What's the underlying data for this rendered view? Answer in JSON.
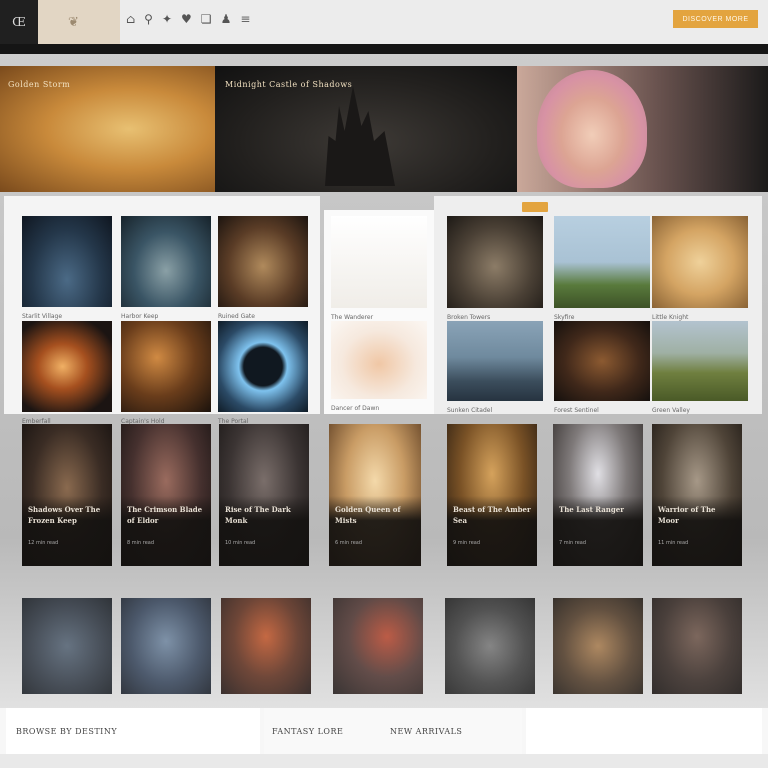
{
  "topbar": {
    "logo": "Œ",
    "cta_label": "DISCOVER MORE"
  },
  "hero": [
    {
      "caption": "Golden Storm"
    },
    {
      "caption": "Midnight Castle of Shadows"
    },
    {
      "caption": ""
    }
  ],
  "gallery_left": [
    {
      "caption": "Starlit Village",
      "gradient": "radial-gradient(ellipse at 50% 70%, #4b6a86 0%, #24374a 55%, #0f1620 100%)"
    },
    {
      "caption": "Harbor Keep",
      "gradient": "radial-gradient(ellipse at 50% 60%, #8aa0a6 0%, #3a5565 50%, #17232b 100%)"
    },
    {
      "caption": "Ruined Gate",
      "gradient": "radial-gradient(ellipse at 50% 55%, #b08a5c 0%, #5a3c26 55%, #1c140f 100%)"
    },
    {
      "caption": "Emberfall",
      "gradient": "radial-gradient(ellipse at 45% 50%, #f0b064 0%, #a6501f 35%, #1b1412 80%)"
    },
    {
      "caption": "Captain's Hold",
      "gradient": "radial-gradient(ellipse at 40% 40%, #d08a43 0%, #6a3d1b 50%, #1b120c 100%)"
    },
    {
      "caption": "The Portal",
      "gradient": "radial-gradient(circle at 50% 50%, #101820 0%, #101820 30%, #7ec2ee 38%, #2b4a66 70%, #0f1b26 100%)"
    }
  ],
  "gallery_mid": [
    {
      "caption": "The Wanderer",
      "gradient": "linear-gradient(#ffffff, #f0ede8)"
    },
    {
      "caption": "Dancer of Dawn",
      "gradient": "radial-gradient(ellipse at 50% 55%, #f0c7a5 0%, #f6e9de 55%, #fbf7f3 100%)"
    }
  ],
  "gallery_right": [
    {
      "caption": "Broken Towers",
      "gradient": "radial-gradient(ellipse at 50% 55%, #8c7c67 0%, #4a4035 55%, #1d1915 100%)"
    },
    {
      "caption": "Skyfire",
      "gradient": "linear-gradient(#b8cfe0 0%, #a9c2d4 50%, #597a3c 75%, #3d5227 100%)"
    },
    {
      "caption": "Little Knight",
      "gradient": "radial-gradient(ellipse at 50% 50%, #efd19a 0%, #d4a463 50%, #8a6335 100%)"
    },
    {
      "caption": "Sunken Citadel",
      "gradient": "linear-gradient(#8aa3b7 0%, #6f8a9e 45%, #3c4e5d 75%, #263340 100%)"
    },
    {
      "caption": "Forest Sentinel",
      "gradient": "radial-gradient(ellipse at 50% 50%, #8c5a31 0%, #40281a 55%, #15100d 100%)"
    },
    {
      "caption": "Green Valley",
      "gradient": "linear-gradient(#b3c3cf 0%, #9fb0a4 40%, #6f7f3f 65%, #4a5a27 100%)"
    }
  ],
  "cards": [
    {
      "title": "Shadows Over The Frozen Keep",
      "sub": "12 min read",
      "gradient": "radial-gradient(ellipse at 50% 45%, #8a6a4f 0%, #3a2c24 55%, #171210 100%)"
    },
    {
      "title": "The Crimson Blade of Eldor",
      "sub": "8 min read",
      "gradient": "radial-gradient(ellipse at 50% 40%, #9a6b5e 0%, #45302e 55%, #191413 100%)"
    },
    {
      "title": "Rise of The Dark Monk",
      "sub": "10 min read",
      "gradient": "radial-gradient(ellipse at 50% 40%, #7a6e6a 0%, #3b3433 55%, #1a1716 100%)"
    },
    {
      "title": "Golden Queen of Mists",
      "sub": "6 min read",
      "gradient": "radial-gradient(ellipse at 50% 40%, #f4d9aa 0%, #c99c65 45%, #6b4a2b 90%)"
    },
    {
      "title": "Beast of The Amber Sea",
      "sub": "9 min read",
      "gradient": "radial-gradient(ellipse at 50% 35%, #d5a25c 0%, #7a5226 50%, #221810 100%)"
    },
    {
      "title": "The Last Ranger",
      "sub": "7 min read",
      "gradient": "radial-gradient(ellipse at 50% 35%, #e0dfe4 0%, #7f7a7a 45%, #2b2624 100%)"
    },
    {
      "title": "Warrior of The Moor",
      "sub": "11 min read",
      "gradient": "radial-gradient(ellipse at 50% 40%, #a69887 0%, #4f4438 55%, #1d1814 100%)"
    }
  ],
  "bottom_row": [
    {
      "gradient": "radial-gradient(ellipse at 50% 50%, #536273 0%, #2d3540 60%, #151a20 100%)"
    },
    {
      "gradient": "radial-gradient(ellipse at 50% 45%, #6f86a0 0%, #35445a 55%, #141a24 100%)"
    },
    {
      "gradient": "radial-gradient(ellipse at 50% 40%, #c2562a 0%, #5d2e1d 50%, #1d1210 100%)"
    },
    {
      "gradient": "radial-gradient(ellipse at 60% 40%, #b8472e 0%, #4e3430 50%, #1d1716 100%)"
    },
    {
      "gradient": "radial-gradient(ellipse at 50% 50%, #777 0%, #3c3c3c 55%, #1c1c1c 100%)"
    },
    {
      "gradient": "radial-gradient(ellipse at 50% 50%, #a77b4d 0%, #4f3a27 55%, #1e1711 100%)"
    },
    {
      "gradient": "radial-gradient(ellipse at 50% 40%, #6d5448 0%, #332722 55%, #140f0d 100%)"
    }
  ],
  "footer": {
    "left": "BROWSE BY DESTINY",
    "mid": "FANTASY LORE",
    "right": "NEW ARRIVALS"
  }
}
